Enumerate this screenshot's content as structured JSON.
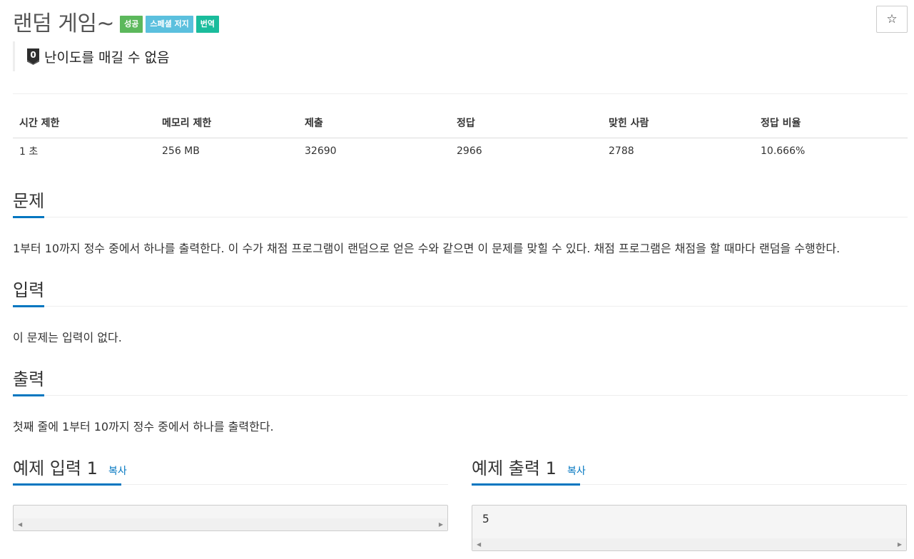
{
  "problem": {
    "title": "랜덤 게임~",
    "badges": {
      "success": "성공",
      "special": "스페셜 저지",
      "translated": "번역"
    },
    "tier_number": "0",
    "difficulty": "난이도를 매길 수 없음",
    "star_icon": "☆"
  },
  "stats": {
    "headers": [
      "시간 제한",
      "메모리 제한",
      "제출",
      "정답",
      "맞힌 사람",
      "정답 비율"
    ],
    "values": [
      "1 초",
      "256 MB",
      "32690",
      "2966",
      "2788",
      "10.666%"
    ]
  },
  "sections": {
    "description": {
      "title": "문제",
      "body": "1부터 10까지 정수 중에서 하나를 출력한다. 이 수가 채점 프로그램이 랜덤으로 얻은 수와 같으면 이 문제를 맞힐 수 있다. 채점 프로그램은 채점을 할 때마다 랜덤을 수행한다."
    },
    "input": {
      "title": "입력",
      "body": "이 문제는 입력이 없다."
    },
    "output": {
      "title": "출력",
      "body": "첫째 줄에 1부터 10까지 정수 중에서 하나를 출력한다."
    }
  },
  "samples": {
    "input": {
      "title": "예제 입력 1",
      "copy_label": "복사",
      "content": ""
    },
    "output": {
      "title": "예제 출력 1",
      "copy_label": "복사",
      "content": "5"
    }
  },
  "colors": {
    "accent": "#0076c0",
    "success_badge": "#5cb85c",
    "special_badge": "#5bc0de",
    "translated_badge": "#1abc9c"
  }
}
